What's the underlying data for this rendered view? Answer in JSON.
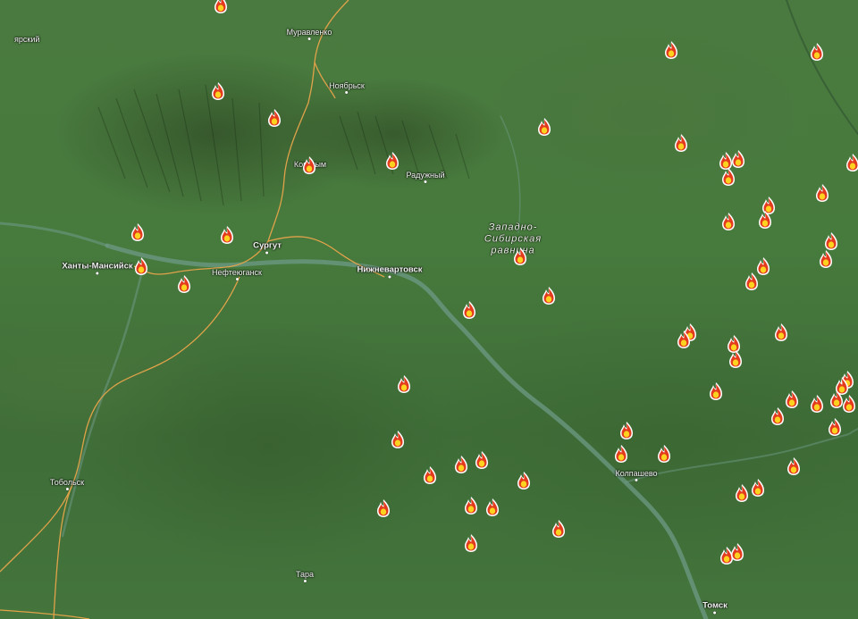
{
  "map": {
    "region_label": {
      "line1": "Западно-",
      "line2": "Сибирская",
      "line3": "равнина"
    },
    "cities": [
      {
        "name": "Муравленко"
      },
      {
        "name": "Ноябрьск"
      },
      {
        "name": "Когалым"
      },
      {
        "name": "Радужный"
      },
      {
        "name": "Сургут"
      },
      {
        "name": "Ханты-Мансийск"
      },
      {
        "name": "Нефтеюганск"
      },
      {
        "name": "Нижневартовск"
      },
      {
        "name": "Колпашево"
      },
      {
        "name": "Тобольск"
      },
      {
        "name": "Тара"
      },
      {
        "name": "Томск"
      },
      {
        "name": "ярский"
      }
    ],
    "fire_icon": "fire-icon",
    "colors": {
      "road": "#e0a24a",
      "river": "#6f9a86",
      "fire_outer": "#e23b1e",
      "fire_inner": "#ffd21f"
    }
  }
}
